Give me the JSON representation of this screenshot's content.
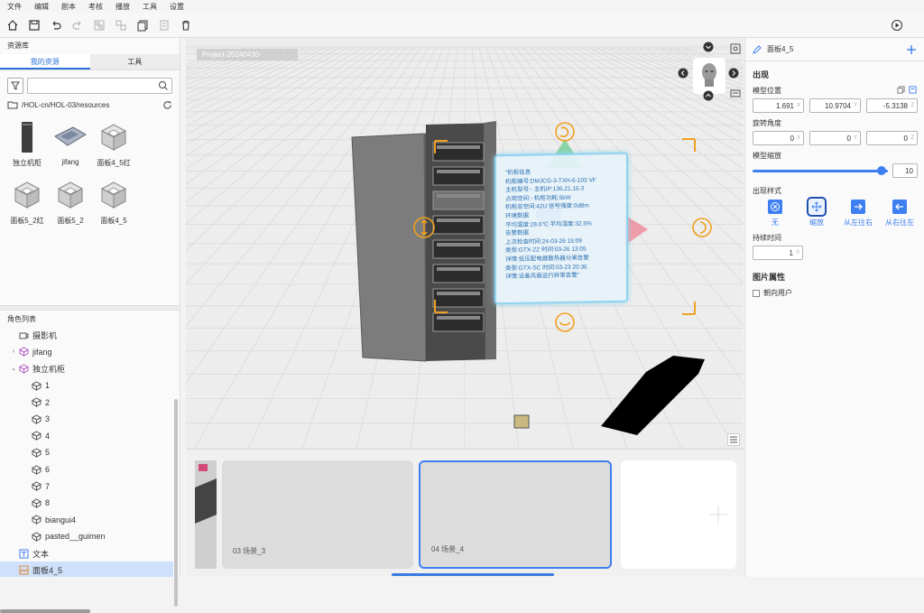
{
  "menu": [
    "文件",
    "编辑",
    "剧本",
    "考核",
    "播放",
    "工具",
    "设置"
  ],
  "left_panel": {
    "title": "资源库",
    "tabs": [
      {
        "label": "我的资源",
        "active": true
      },
      {
        "label": "工具",
        "active": false
      }
    ],
    "search": {
      "placeholder": "",
      "value": ""
    },
    "path": "/HOL-cn/HOL-03/resources",
    "assets": [
      {
        "label": "独立机柜",
        "icon": "cabinet-thumbnail"
      },
      {
        "label": "jifang",
        "icon": "server-room-thumbnail"
      },
      {
        "label": "面板4_5红",
        "icon": "cube-icon"
      },
      {
        "label": "面板5_2红",
        "icon": "cube-icon"
      },
      {
        "label": "面板5_2",
        "icon": "cube-icon"
      },
      {
        "label": "面板4_5",
        "icon": "cube-icon"
      }
    ],
    "role_list_title": "角色列表",
    "tree": [
      {
        "label": "摄影机",
        "depth": 1,
        "arrow": "",
        "icon": "camera-icon"
      },
      {
        "label": "jifang",
        "depth": 1,
        "arrow": "›",
        "icon": "group-icon"
      },
      {
        "label": "独立机柜",
        "depth": 1,
        "arrow": "⌄",
        "icon": "group-icon"
      },
      {
        "label": "1",
        "depth": 2,
        "arrow": "",
        "icon": "cube-icon"
      },
      {
        "label": "2",
        "depth": 2,
        "arrow": "",
        "icon": "cube-icon"
      },
      {
        "label": "3",
        "depth": 2,
        "arrow": "",
        "icon": "cube-icon"
      },
      {
        "label": "4",
        "depth": 2,
        "arrow": "",
        "icon": "cube-icon"
      },
      {
        "label": "5",
        "depth": 2,
        "arrow": "",
        "icon": "cube-icon"
      },
      {
        "label": "6",
        "depth": 2,
        "arrow": "",
        "icon": "cube-icon"
      },
      {
        "label": "7",
        "depth": 2,
        "arrow": "",
        "icon": "cube-icon"
      },
      {
        "label": "8",
        "depth": 2,
        "arrow": "",
        "icon": "cube-icon"
      },
      {
        "label": "biangui4",
        "depth": 2,
        "arrow": "",
        "icon": "cube-icon"
      },
      {
        "label": "pasted__guimen",
        "depth": 2,
        "arrow": "",
        "icon": "cube-icon"
      },
      {
        "label": "文本",
        "depth": 1,
        "arrow": "",
        "icon": "text-icon"
      },
      {
        "label": "面板4_5",
        "depth": 1,
        "arrow": "",
        "icon": "image-icon",
        "selected": true
      }
    ]
  },
  "viewport": {
    "project_tag": "Project-20240430-",
    "info_card": [
      "\"机柜信息",
      "机柜编号:DMJCG-3-TXH-6-103 VF",
      "主机型号:-      主机IP:136.21.16.3",
      "占用空间:-         机柜功耗:5kW",
      "机柜总空间:42U   信号强度:0dBm",
      "环境数据",
      "平均温度:28.6°C    平均湿度:32.5%",
      "告警数据",
      "上次检查时间:24-03-26 15:09",
      "类型:GTX-ZZ    时间:03-26 13:05",
      "详情:低压配电器散热器分闸告警",
      "类型:GTX-SC    时间:03-23 20:36",
      "详情:设备风扇运行异常告警\""
    ]
  },
  "filmstrip": {
    "scenes": [
      {
        "label": "03  场景_3",
        "selected": false
      },
      {
        "label": "04  场景_4",
        "selected": true
      }
    ]
  },
  "right_panel": {
    "title": "面板4_5",
    "appear_section": "出现",
    "position_label": "模型位置",
    "position": [
      {
        "v": "1.691",
        "ax": "X"
      },
      {
        "v": "10.9704",
        "ax": "Y"
      },
      {
        "v": "-5.3138",
        "ax": "Z"
      }
    ],
    "rotation_label": "旋转角度",
    "rotation": [
      {
        "v": "0",
        "ax": "X"
      },
      {
        "v": "0",
        "ax": "Y"
      },
      {
        "v": "0",
        "ax": "Z"
      }
    ],
    "scale_label": "模型缩放",
    "scale_value": "10",
    "scale_fraction": 0.96,
    "style_label": "出现样式",
    "styles": [
      {
        "label": "无",
        "icon": "none-icon",
        "selected": false
      },
      {
        "label": "缩放",
        "icon": "zoom-icon",
        "selected": true
      },
      {
        "label": "从左往右",
        "icon": "arrow-right-icon",
        "selected": false
      },
      {
        "label": "从右往左",
        "icon": "arrow-left-icon",
        "selected": false
      }
    ],
    "duration_label": "持续时间",
    "duration_value": "1",
    "duration_unit": "S",
    "image_props_section": "图片属性",
    "face_user_label": "朝向用户"
  },
  "colors": {
    "accent": "#3d7ff0",
    "info_text": "#2a6fb0",
    "gizmo": "#f0a020"
  }
}
